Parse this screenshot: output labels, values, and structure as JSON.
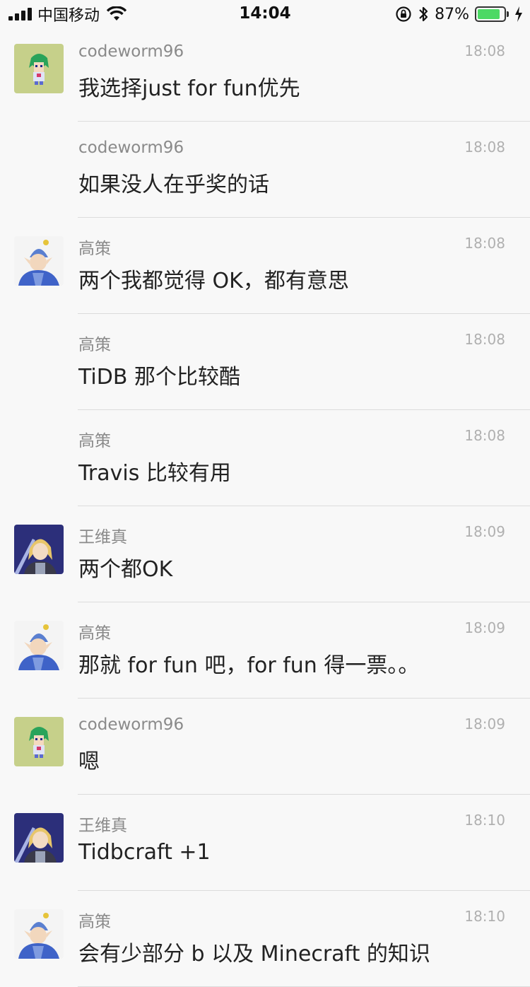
{
  "status_bar": {
    "carrier": "中国移动",
    "time": "14:04",
    "battery_percent": "87%",
    "battery_level": 0.87
  },
  "messages": [
    {
      "user": "codeworm96",
      "time": "18:08",
      "text": "我选择just for fun优先",
      "avatar": "green-hair-avatar",
      "show_avatar": true
    },
    {
      "user": "codeworm96",
      "time": "18:08",
      "text": "如果没人在乎奖的话",
      "avatar": "green-hair-avatar",
      "show_avatar": false
    },
    {
      "user": "高策",
      "time": "18:08",
      "text": "两个我都觉得 OK，都有意思",
      "avatar": "blue-hat-avatar",
      "show_avatar": true
    },
    {
      "user": "高策",
      "time": "18:08",
      "text": "TiDB 那个比较酷",
      "avatar": "blue-hat-avatar",
      "show_avatar": false
    },
    {
      "user": "高策",
      "time": "18:08",
      "text": "Travis 比较有用",
      "avatar": "blue-hat-avatar",
      "show_avatar": false
    },
    {
      "user": "王维真",
      "time": "18:09",
      "text": "两个都OK",
      "avatar": "knight-avatar",
      "show_avatar": true
    },
    {
      "user": "高策",
      "time": "18:09",
      "text": "那就 for fun 吧，for fun 得一票。。",
      "avatar": "blue-hat-avatar",
      "show_avatar": true
    },
    {
      "user": "codeworm96",
      "time": "18:09",
      "text": "嗯",
      "avatar": "green-hair-avatar",
      "show_avatar": true
    },
    {
      "user": "王维真",
      "time": "18:10",
      "text": "Tidbcraft +1",
      "avatar": "knight-avatar",
      "show_avatar": true
    },
    {
      "user": "高策",
      "time": "18:10",
      "text": "会有少部分 b 以及 Minecraft 的知识",
      "avatar": "blue-hat-avatar",
      "show_avatar": true
    }
  ]
}
